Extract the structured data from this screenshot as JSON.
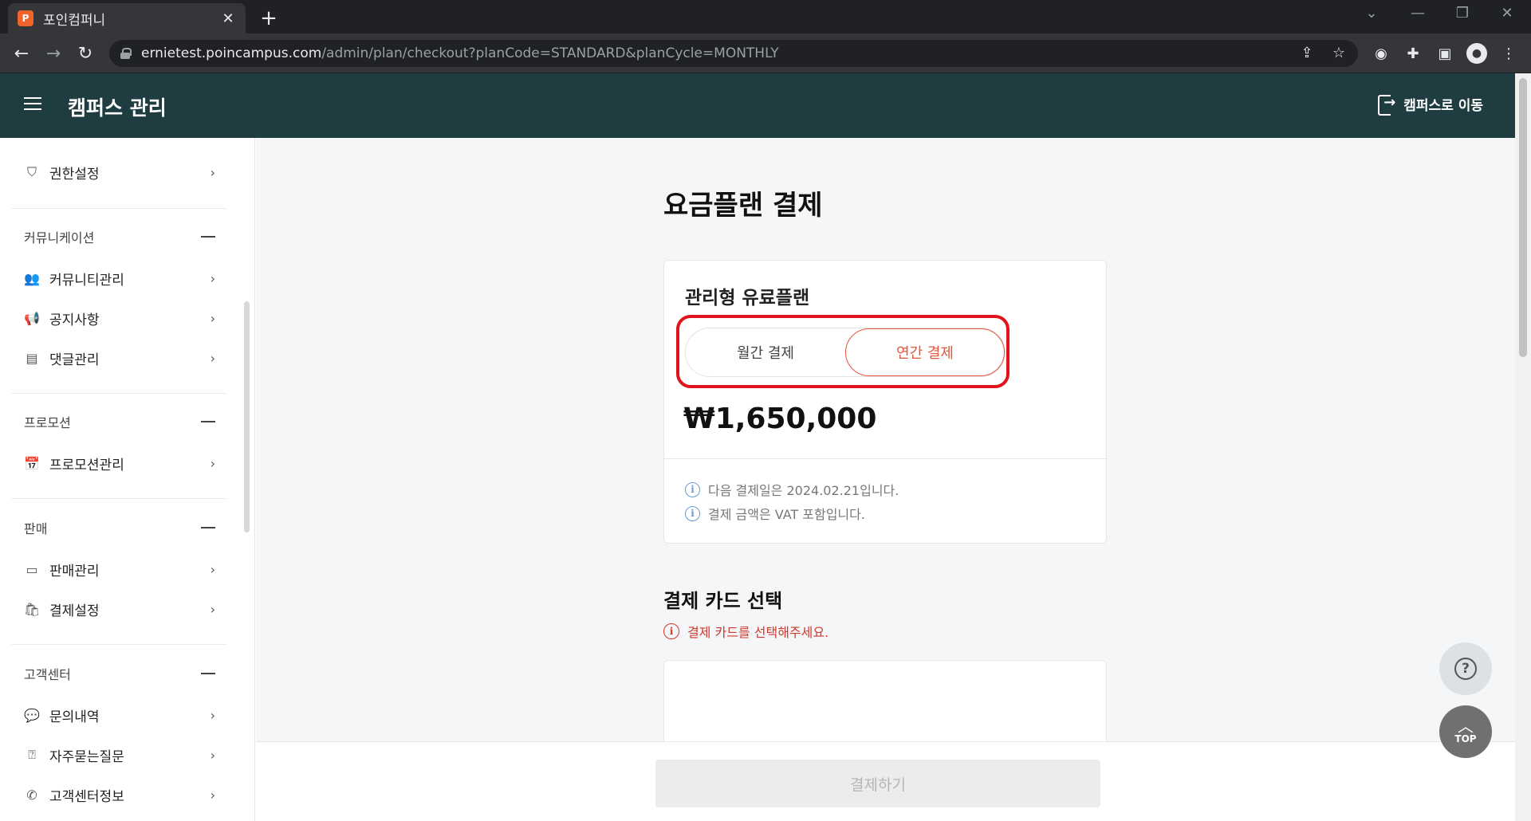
{
  "browser": {
    "tab_title": "포인컴퍼니",
    "tab_favicon": "P",
    "new_tab": "+",
    "url_host": "ernietest.poincampus.com",
    "url_path": "/admin/plan/checkout?planCode=STANDARD&planCycle=MONTHLY"
  },
  "header": {
    "title": "캠퍼스 관리",
    "goto_campus": "캠퍼스로 이동"
  },
  "sidebar": {
    "top_item": "권한설정",
    "groups": [
      {
        "label": "커뮤니케이션",
        "items": [
          "커뮤니티관리",
          "공지사항",
          "댓글관리"
        ]
      },
      {
        "label": "프로모션",
        "items": [
          "프로모션관리"
        ]
      },
      {
        "label": "판매",
        "items": [
          "판매관리",
          "결제설정"
        ]
      },
      {
        "label": "고객센터",
        "items": [
          "문의내역",
          "자주묻는질문",
          "고객센터정보"
        ]
      }
    ]
  },
  "main": {
    "page_title": "요금플랜 결제",
    "plan": {
      "name": "관리형 유료플랜",
      "toggle_monthly": "월간 결제",
      "toggle_yearly": "연간 결제",
      "selected": "연간 결제",
      "price": "₩1,650,000",
      "notes": [
        "다음 결제일은 2024.02.21입니다.",
        "결제 금액은 VAT 포함입니다."
      ]
    },
    "card_section_title": "결제 카드 선택",
    "card_warning": "결제 카드를 선택해주세요.",
    "pay_button": "결제하기"
  },
  "fab": {
    "help": "?",
    "top": "TOP"
  },
  "colors": {
    "header_bg": "#1f3d40",
    "accent": "#e2563b",
    "highlight": "#e0151b",
    "info": "#6a9bd1"
  }
}
